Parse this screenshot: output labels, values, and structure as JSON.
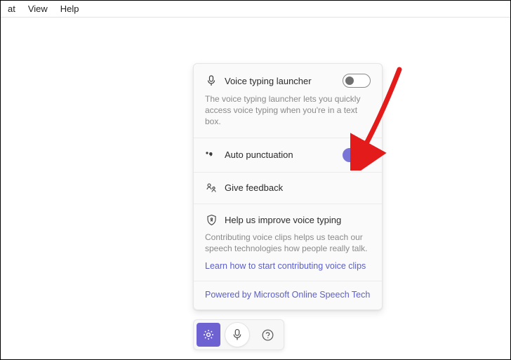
{
  "menubar": {
    "item0": "at",
    "item1": "View",
    "item2": "Help"
  },
  "panel": {
    "launcher": {
      "title": "Voice typing launcher",
      "desc": "The voice typing launcher lets you quickly access voice typing when you're in a text box.",
      "toggle": false
    },
    "autopunct": {
      "title": "Auto punctuation",
      "toggle": true
    },
    "feedback": {
      "title": "Give feedback"
    },
    "help_improve": {
      "title": "Help us improve voice typing",
      "desc": "Contributing voice clips helps us teach our speech technologies how people really talk.",
      "link": "Learn how to start contributing voice clips"
    },
    "footer": "Powered by Microsoft Online Speech Tech"
  }
}
